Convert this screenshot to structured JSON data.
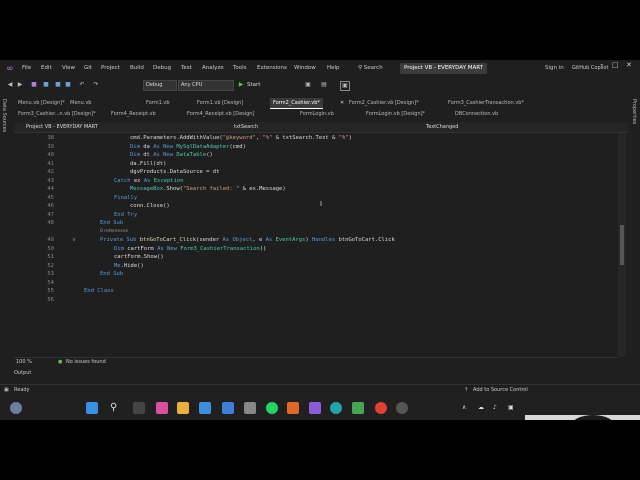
{
  "titlebar": {
    "menu": [
      "File",
      "Edit",
      "View",
      "Git",
      "Project",
      "Build",
      "Debug",
      "Test",
      "Analyze",
      "Tools",
      "Extensions",
      "Window",
      "Help"
    ],
    "search_label": "Search",
    "project_name": "Project VB - EVERYDAY MART",
    "sign_in": "Sign in",
    "copilot": "GitHub Copilot"
  },
  "toolbar": {
    "config": "Debug",
    "platform": "Any CPU",
    "start_label": "Start"
  },
  "side_panels": {
    "left": "Data Sources",
    "right": "Properties"
  },
  "tabs_row1": [
    "Menu.vb [Design]*",
    "Menu.vb",
    "Form1.vb",
    "Form1.vb [Design]",
    "Form2_Cashier.vb*",
    "Form2_Cashier.vb [Design]*",
    "Form3_CashierTransaction.vb*"
  ],
  "tabs_row2": [
    "Form3_Cashier...n.vb [Design]*",
    "Form4_Receipt.vb",
    "Form4_Receipt.vb [Design]",
    "FormLogin.vb",
    "FormLogin.vb [Design]*",
    "DBConnection.vb"
  ],
  "active_tab_index": 4,
  "navbar": {
    "project": "Project VB - EVERYDAY MART",
    "object": "txtSearch",
    "event": "TextChanged"
  },
  "code": {
    "lines": [
      "38",
      "39",
      "40",
      "41",
      "42",
      "43",
      "44",
      "45",
      "46",
      "47",
      "48",
      "49",
      "50",
      "51",
      "52",
      "53",
      "54",
      "55",
      "56"
    ],
    "references": "0 references",
    "l38_a": "cmd.Parameters.AddWithValue(",
    "l38_b": "\"@keyword\"",
    "l38_c": ", ",
    "l38_d": "\"%\"",
    "l38_e": " & txtSearch.Text & ",
    "l38_f": "\"%\"",
    "l38_g": ")",
    "l39_kw1": "Dim",
    "l39_a": " da ",
    "l39_kw2": "As New",
    "l39_ty": " MySqlDataAdapter",
    "l39_b": "(cmd)",
    "l40_kw1": "Dim",
    "l40_a": " dt ",
    "l40_kw2": "As New",
    "l40_ty": " DataTable",
    "l40_b": "()",
    "l41": "da.Fill(dt)",
    "l42": "dgvProducts.DataSource = dt",
    "l43_kw1": "Catch",
    "l43_a": " ex ",
    "l43_kw2": "As",
    "l43_ty": " Exception",
    "l44_a": "MessageBox",
    "l44_b": ".Show(",
    "l44_str": "\"Search failed: \"",
    "l44_c": " & ex.Message)",
    "l45": "Finally",
    "l46": "conn.Close()",
    "l47": "End Try",
    "l48": "End Sub",
    "l49_kw1": "Private Sub",
    "l49_fn": " btnGoToCart_Click",
    "l49_a": "(sender ",
    "l49_kw2": "As",
    "l49_ty1": " Object",
    "l49_b": ", e ",
    "l49_kw3": "As",
    "l49_ty2": " EventArgs",
    "l49_c": ") ",
    "l49_kw4": "Handles",
    "l49_d": " btnGoToCart.Click",
    "l50_kw1": "Dim",
    "l50_a": " cartForm ",
    "l50_kw2": "As New",
    "l50_ty": " Form3_CashierTransaction",
    "l50_b": "()",
    "l51": "cartForm.Show()",
    "l52_kw": "Me",
    "l52_a": ".Hide()",
    "l53": "End Sub",
    "l55": "End Class"
  },
  "status": {
    "zoom": "100 %",
    "issues": "No issues found",
    "output": "Output",
    "ready": "Ready",
    "source_control": "Add to Source Control"
  },
  "colors": {
    "bg": "#1f1f1f",
    "accent": "#569cd6",
    "string": "#d69d85",
    "type": "#4ec9b0"
  }
}
